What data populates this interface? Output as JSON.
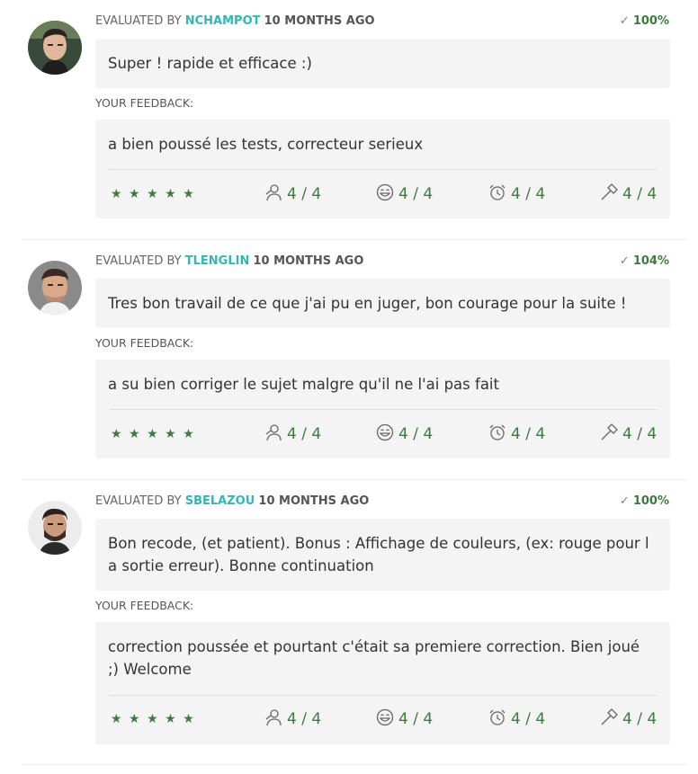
{
  "evaluations": [
    {
      "evaluated_by": "EVALUATED BY",
      "login": "NCHAMPOT",
      "when": "10 MONTHS AGO",
      "score": "100%",
      "comment": "Super ! rapide et efficace :)",
      "feedback_label": "YOUR FEEDBACK:",
      "feedback": "a bien poussé les tests, correcteur serieux",
      "stars": "★★★★★",
      "nice": "4 / 4",
      "friendly": "4 / 4",
      "punctual": "4 / 4",
      "rigorous": "4 / 4"
    },
    {
      "evaluated_by": "EVALUATED BY",
      "login": "TLENGLIN",
      "when": "10 MONTHS AGO",
      "score": "104%",
      "comment": "Tres bon travail de ce que j'ai pu en juger, bon courage pour la suite !",
      "feedback_label": "YOUR FEEDBACK:",
      "feedback": "a su bien corriger le sujet malgre qu'il ne l'ai pas fait",
      "stars": "★★★★★",
      "nice": "4 / 4",
      "friendly": "4 / 4",
      "punctual": "4 / 4",
      "rigorous": "4 / 4"
    },
    {
      "evaluated_by": "EVALUATED BY",
      "login": "SBELAZOU",
      "when": "10 MONTHS AGO",
      "score": "100%",
      "comment": "Bon recode, (et patient). Bonus : Affichage de couleurs, (ex: rouge pour l\na sortie erreur). Bonne continuation",
      "feedback_label": "YOUR FEEDBACK:",
      "feedback": "correction poussée et pourtant c'était sa premiere correction. Bien joué\n;) Welcome",
      "stars": "★★★★★",
      "nice": "4 / 4",
      "friendly": "4 / 4",
      "punctual": "4 / 4",
      "rigorous": "4 / 4"
    }
  ],
  "icons": {
    "score": "check-circle-icon",
    "nice": "person-icon",
    "friendly": "smiley-icon",
    "punctual": "alarm-clock-icon",
    "rigorous": "hammer-icon"
  },
  "colors": {
    "login": "#31b7b7",
    "green": "#3d7a3d",
    "box": "#f4f4f4"
  }
}
